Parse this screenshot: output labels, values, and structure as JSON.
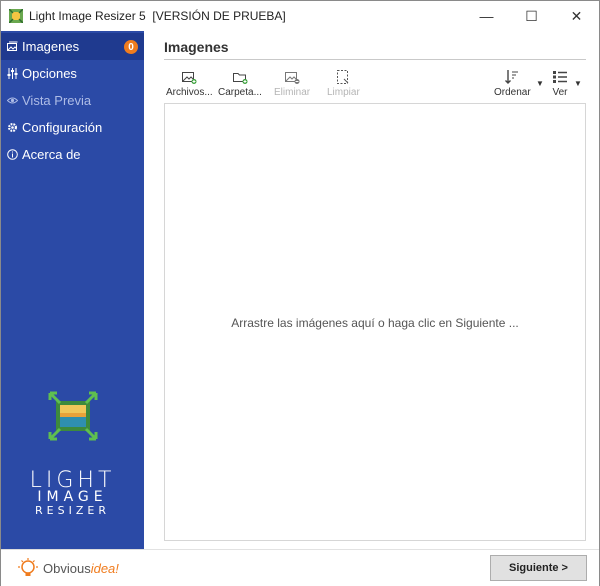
{
  "window": {
    "title": "Light Image Resizer 5  [VERSIÓN DE PRUEBA]",
    "minimize": "—",
    "maximize": "☐",
    "close": "✕"
  },
  "sidebar": {
    "items": [
      {
        "label": "Imagenes",
        "icon": "images-icon",
        "active": true,
        "badge": "0"
      },
      {
        "label": "Opciones",
        "icon": "sliders-icon"
      },
      {
        "label": "Vista Previa",
        "icon": "eye-icon",
        "disabled": true
      },
      {
        "label": "Configuración",
        "icon": "gear-icon"
      },
      {
        "label": "Acerca de",
        "icon": "info-icon"
      }
    ],
    "logo": {
      "line1": "LIGHT",
      "line2": "IMAGE",
      "line3": "RESIZER"
    },
    "brand": {
      "text": "Obvious",
      "accent": "idea!"
    }
  },
  "main": {
    "title": "Imagenes",
    "toolbar": {
      "archivos": "Archivos...",
      "carpeta": "Carpeta...",
      "eliminar": "Eliminar",
      "limpiar": "Limpiar",
      "ordenar": "Ordenar",
      "ver": "Ver"
    },
    "drop_hint": "Arrastre las imágenes aquí o haga clic en Siguiente ...",
    "next_button": "Siguiente >"
  },
  "colors": {
    "sidebar": "#2b4aa6",
    "accent": "#f07c1e"
  }
}
